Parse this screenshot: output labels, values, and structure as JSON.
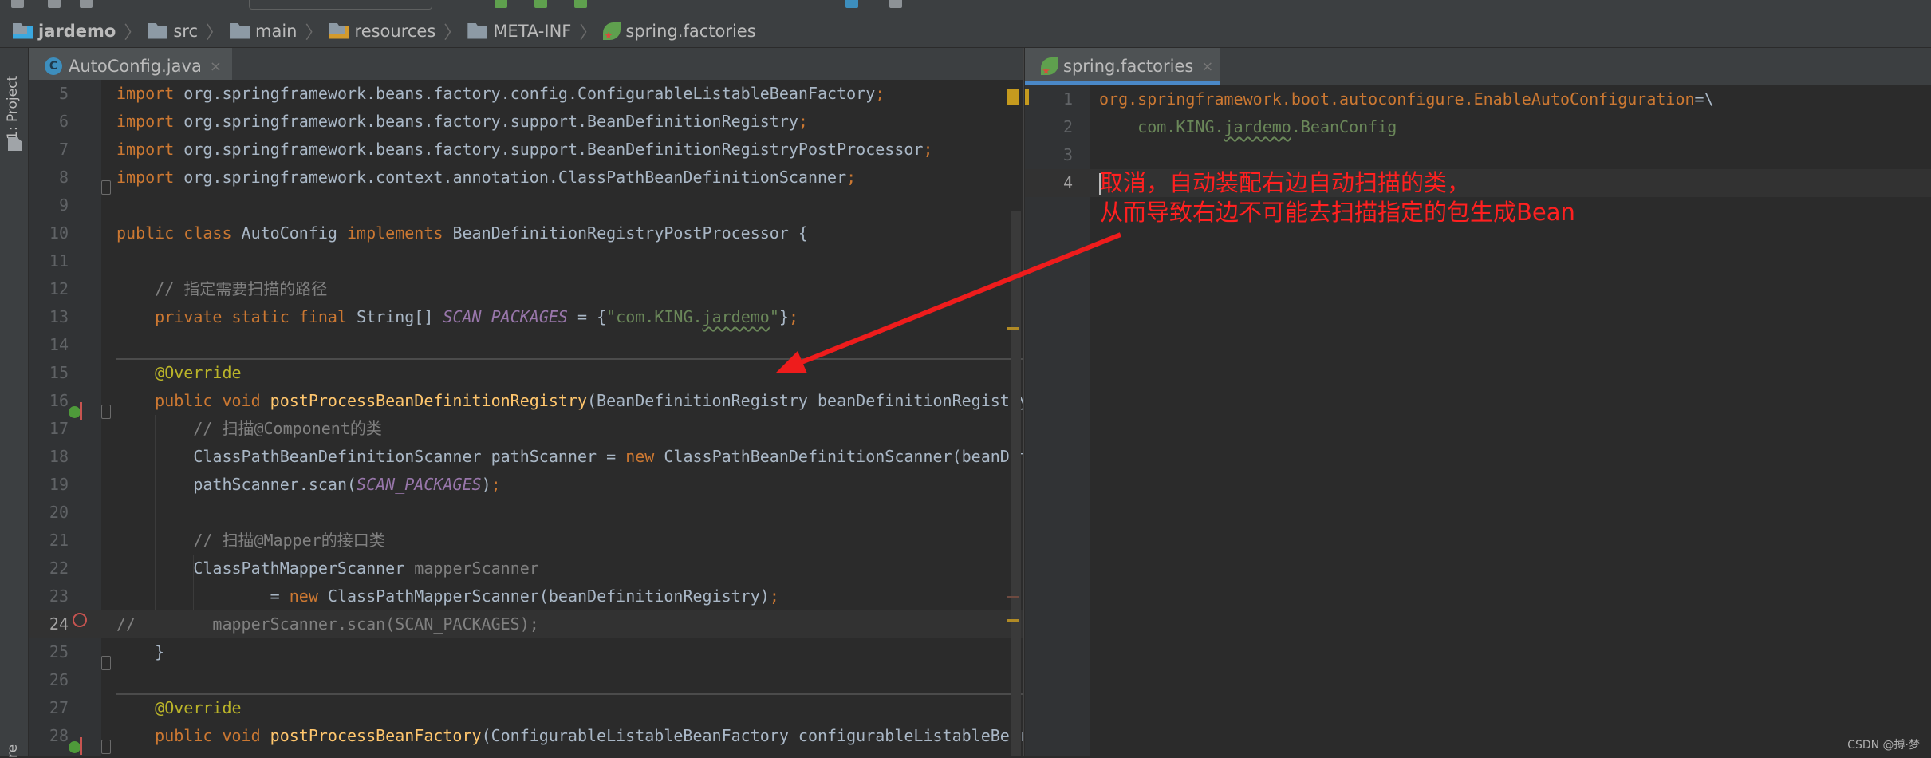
{
  "breadcrumb": [
    {
      "label": "jardemo",
      "icon": "module-folder-icon"
    },
    {
      "label": "src",
      "icon": "folder-icon"
    },
    {
      "label": "main",
      "icon": "folder-icon"
    },
    {
      "label": "resources",
      "icon": "resources-folder-icon"
    },
    {
      "label": "META-INF",
      "icon": "folder-icon"
    },
    {
      "label": "spring.factories",
      "icon": "spring-icon"
    }
  ],
  "toolstrip": {
    "project_label": "1: Project",
    "bottom_label": "re"
  },
  "left_editor": {
    "tab": {
      "label": "AutoConfig.java",
      "icon_letter": "C",
      "close": "×"
    },
    "current_line": 24,
    "lines": [
      {
        "n": 5,
        "t": [
          [
            "import ",
            "kw"
          ],
          [
            "org.springframework.beans.factory.config.ConfigurableListableBeanFactory",
            "id"
          ],
          [
            ";",
            "kw"
          ]
        ]
      },
      {
        "n": 6,
        "t": [
          [
            "import ",
            "kw"
          ],
          [
            "org.springframework.beans.factory.support.BeanDefinitionRegistry",
            "id"
          ],
          [
            ";",
            "kw"
          ]
        ]
      },
      {
        "n": 7,
        "t": [
          [
            "import ",
            "kw"
          ],
          [
            "org.springframework.beans.factory.support.BeanDefinitionRegistryPostProcessor",
            "id"
          ],
          [
            ";",
            "kw"
          ]
        ]
      },
      {
        "n": 8,
        "t": [
          [
            "import ",
            "kw"
          ],
          [
            "org.springframework.context.annotation.ClassPathBeanDefinitionScanner",
            "id"
          ],
          [
            ";",
            "kw"
          ]
        ]
      },
      {
        "n": 9,
        "t": []
      },
      {
        "n": 10,
        "t": [
          [
            "public class ",
            "kw"
          ],
          [
            "AutoConfig ",
            "id"
          ],
          [
            "implements ",
            "kw"
          ],
          [
            "BeanDefinitionRegistryPostProcessor {",
            "id"
          ]
        ]
      },
      {
        "n": 11,
        "t": []
      },
      {
        "n": 12,
        "t": [
          [
            "    // 指定需要扫描的路径",
            "cm"
          ]
        ]
      },
      {
        "n": 13,
        "t": [
          [
            "    private static final ",
            "kw"
          ],
          [
            "String[] ",
            "id"
          ],
          [
            "SCAN_PACKAGES",
            "st"
          ],
          [
            " = {",
            "id"
          ],
          [
            "\"com.KING.",
            "str"
          ],
          [
            "jardemo",
            "str wavy"
          ],
          [
            "\"",
            "str"
          ],
          [
            "}",
            "id"
          ],
          [
            ";",
            "kw"
          ]
        ]
      },
      {
        "n": 14,
        "t": []
      },
      {
        "n": 15,
        "t": [
          [
            "    @Override",
            "an"
          ]
        ]
      },
      {
        "n": 16,
        "t": [
          [
            "    public void ",
            "kw"
          ],
          [
            "postProcessBeanDefinitionRegistry",
            "mt"
          ],
          [
            "(BeanDefinitionRegistry beanDefinitionRegistry",
            "id"
          ]
        ]
      },
      {
        "n": 17,
        "t": [
          [
            "        // 扫描@Component的类",
            "cm"
          ]
        ]
      },
      {
        "n": 18,
        "t": [
          [
            "        ClassPathBeanDefinitionScanner pathScanner = ",
            "id"
          ],
          [
            "new ",
            "kw"
          ],
          [
            "ClassPathBeanDefinitionScanner(beanDef",
            "id"
          ]
        ]
      },
      {
        "n": 19,
        "t": [
          [
            "        pathScanner.scan(",
            "id"
          ],
          [
            "SCAN_PACKAGES",
            "st"
          ],
          [
            ")",
            "id"
          ],
          [
            ";",
            "kw"
          ]
        ]
      },
      {
        "n": 20,
        "t": []
      },
      {
        "n": 21,
        "t": [
          [
            "        // 扫描@Mapper的接口类",
            "cm"
          ]
        ]
      },
      {
        "n": 22,
        "t": [
          [
            "        ClassPathMapperScanner ",
            "id"
          ],
          [
            "mapperScanner",
            "un"
          ]
        ]
      },
      {
        "n": 23,
        "t": [
          [
            "                = ",
            "id"
          ],
          [
            "new ",
            "kw"
          ],
          [
            "ClassPathMapperScanner(beanDefinitionRegistry)",
            "id"
          ],
          [
            ";",
            "kw"
          ]
        ]
      },
      {
        "n": 24,
        "t": [
          [
            "//        mapperScanner.scan(SCAN_PACKAGES);",
            "cm"
          ]
        ]
      },
      {
        "n": 25,
        "t": [
          [
            "    }",
            "id"
          ]
        ]
      },
      {
        "n": 26,
        "t": []
      },
      {
        "n": 27,
        "t": [
          [
            "    @Override",
            "an"
          ]
        ]
      },
      {
        "n": 28,
        "t": [
          [
            "    public void ",
            "kw"
          ],
          [
            "postProcessBeanFactory",
            "mt"
          ],
          [
            "(ConfigurableListableBeanFactory configurableListableBear",
            "id"
          ]
        ]
      }
    ]
  },
  "right_editor": {
    "tab": {
      "label": "spring.factories",
      "close": "×"
    },
    "current_line": 4,
    "lines": [
      {
        "n": 1,
        "t": [
          [
            "org.springframework.boot.autoconfigure.EnableAutoConfiguration",
            "pk"
          ],
          [
            "=\\",
            "id"
          ]
        ]
      },
      {
        "n": 2,
        "t": [
          [
            "    com.KING.",
            "str"
          ],
          [
            "jardemo",
            "str wavy"
          ],
          [
            ".BeanConfig",
            "str"
          ]
        ]
      },
      {
        "n": 3,
        "t": []
      },
      {
        "n": 4,
        "t": []
      }
    ]
  },
  "annotation": {
    "line1": "取消，自动装配右边自动扫描的类，",
    "line2": "从而导致右边不可能去扫描指定的包生成Bean",
    "color": "#ff2020"
  },
  "watermark": "CSDN @搏·梦",
  "colors": {
    "accent_tab": "#4a88c7",
    "keyword": "#cc7832",
    "string": "#6a8759",
    "comment": "#808080"
  }
}
